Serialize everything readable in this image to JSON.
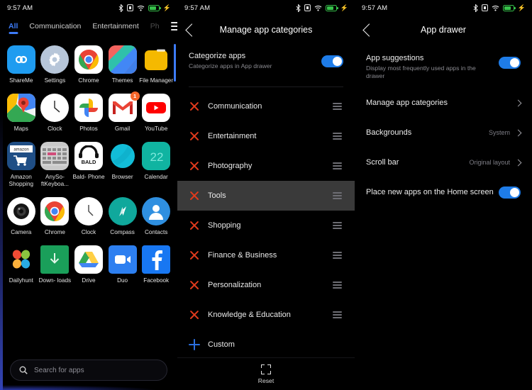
{
  "status_bar": {
    "time": "9:57 AM",
    "icons": [
      "bluetooth-icon",
      "sim-card-icon",
      "wifi-icon",
      "battery-icon",
      "charging-bolt-icon"
    ],
    "battery_color": "#36c24a"
  },
  "theme": {
    "background": "#000000",
    "accent": "#3d7bf7",
    "toggle_on": "#1e7ce8",
    "delete_red": "#e03a1c",
    "add_blue": "#2b6fe0"
  },
  "app_drawer": {
    "tabs": [
      {
        "label": "All",
        "active": true
      },
      {
        "label": "Communication",
        "active": false
      },
      {
        "label": "Entertainment",
        "active": false
      },
      {
        "label": "Ph",
        "active": false,
        "clipped": true
      }
    ],
    "menu_icon": "hamburger-menu-icon",
    "apps": [
      [
        {
          "name": "ShareMe",
          "icon": "shareme-icon"
        },
        {
          "name": "Settings",
          "icon": "settings-gear-icon"
        },
        {
          "name": "Chrome",
          "icon": "chrome-icon"
        },
        {
          "name": "Themes",
          "icon": "themes-icon"
        },
        {
          "name": "File Manager",
          "icon": "file-manager-icon"
        }
      ],
      [
        {
          "name": "Maps",
          "icon": "google-maps-icon"
        },
        {
          "name": "Clock",
          "icon": "clock-icon"
        },
        {
          "name": "Photos",
          "icon": "google-photos-icon"
        },
        {
          "name": "Gmail",
          "icon": "gmail-icon",
          "badge": "1"
        },
        {
          "name": "YouTube",
          "icon": "youtube-icon"
        }
      ],
      [
        {
          "name": "Amazon Shopping",
          "icon": "amazon-shopping-icon"
        },
        {
          "name": "AnySo- ftKeyboa...",
          "icon": "anysoftkeyboard-icon"
        },
        {
          "name": "Bald- Phone",
          "icon": "baldphone-icon"
        },
        {
          "name": "Browser",
          "icon": "browser-icon"
        },
        {
          "name": "Calendar",
          "icon": "calendar-icon",
          "day": "22"
        }
      ],
      [
        {
          "name": "Camera",
          "icon": "camera-icon"
        },
        {
          "name": "Chrome",
          "icon": "chrome-icon"
        },
        {
          "name": "Clock",
          "icon": "clock-icon"
        },
        {
          "name": "Compass",
          "icon": "compass-icon"
        },
        {
          "name": "Contacts",
          "icon": "contacts-icon"
        }
      ],
      [
        {
          "name": "Dailyhunt",
          "icon": "dailyhunt-icon"
        },
        {
          "name": "Down- loads",
          "icon": "downloads-icon"
        },
        {
          "name": "Drive",
          "icon": "google-drive-icon"
        },
        {
          "name": "Duo",
          "icon": "google-duo-icon"
        },
        {
          "name": "Facebook",
          "icon": "facebook-icon"
        }
      ]
    ],
    "search": {
      "placeholder": "Search for apps",
      "icon": "search-icon"
    }
  },
  "manage_categories": {
    "title": "Manage app categories",
    "back_icon": "back-chevron-icon",
    "categorize": {
      "title": "Categorize apps",
      "subtitle": "Categorize apps in App drawer",
      "toggle_on": true
    },
    "categories": [
      {
        "label": "Communication",
        "action": "remove",
        "selected": false
      },
      {
        "label": "Entertainment",
        "action": "remove",
        "selected": false
      },
      {
        "label": "Photography",
        "action": "remove",
        "selected": false
      },
      {
        "label": "Tools",
        "action": "remove",
        "selected": true
      },
      {
        "label": "Shopping",
        "action": "remove",
        "selected": false
      },
      {
        "label": "Finance & Business",
        "action": "remove",
        "selected": false
      },
      {
        "label": "Personalization",
        "action": "remove",
        "selected": false
      },
      {
        "label": "Knowledge & Education",
        "action": "remove",
        "selected": false
      },
      {
        "label": "Custom",
        "action": "add",
        "selected": false
      }
    ],
    "reset": {
      "label": "Reset",
      "icon": "reset-icon"
    }
  },
  "app_drawer_settings": {
    "title": "App drawer",
    "back_icon": "back-chevron-icon",
    "suggestions": {
      "title": "App suggestions",
      "subtitle": "Display most frequently used apps in the drawer",
      "toggle_on": true
    },
    "rows": [
      {
        "title": "Manage app categories",
        "value": "",
        "type": "chevron"
      },
      {
        "title": "Backgrounds",
        "value": "System",
        "type": "chevron"
      },
      {
        "title": "Scroll bar",
        "value": "Original layout",
        "type": "chevron"
      },
      {
        "title": "Place new apps on the Home screen",
        "value": "",
        "type": "toggle",
        "toggle_on": true
      }
    ]
  }
}
